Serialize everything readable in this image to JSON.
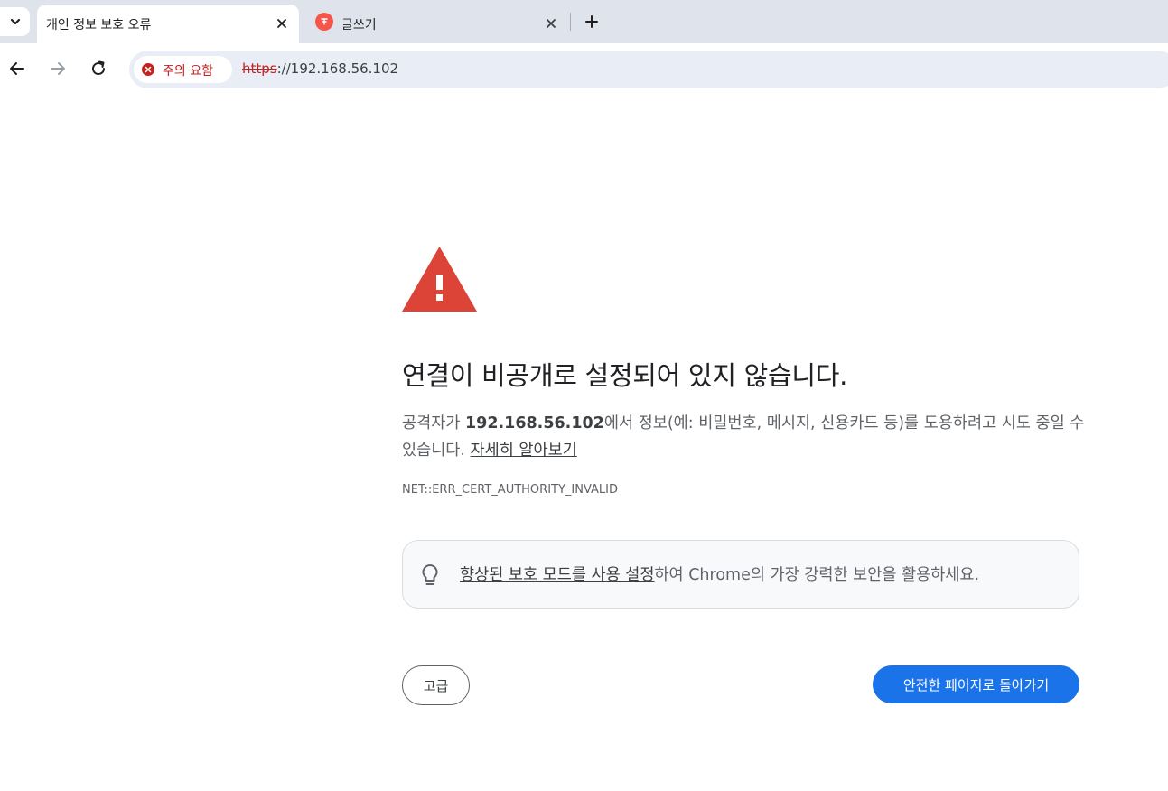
{
  "tabs": [
    {
      "title": "개인 정보 보호 오류",
      "active": true
    },
    {
      "title": "글쓰기",
      "active": false,
      "favicon_color": "#f4574a"
    }
  ],
  "toolbar": {
    "security_chip": "주의 요함",
    "url_scheme": "https",
    "url_rest": "://192.168.56.102"
  },
  "interstitial": {
    "heading": "연결이 비공개로 설정되어 있지 않습니다.",
    "desc_prefix": "공격자가 ",
    "desc_host": "192.168.56.102",
    "desc_suffix": "에서 정보(예: 비밀번호, 메시지, 신용카드 등)를 도용하려고 시도 중일 수 있습니다. ",
    "learn_more": "자세히 알아보기",
    "error_code": "NET::ERR_CERT_AUTHORITY_INVALID",
    "promo_link": "향상된 보호 모드를 사용 설정",
    "promo_rest": "하여 Chrome의 가장 강력한 보안을 활용하세요.",
    "advanced_button": "고급",
    "back_button": "안전한 페이지로 돌아가기"
  },
  "colors": {
    "tabstrip": "#dfe3eb",
    "warning_red": "#db4437",
    "primary_blue": "#1a73e8",
    "danger_text": "#c5221f"
  },
  "icons": [
    "tab-search-icon",
    "close-icon",
    "plus-icon",
    "back-arrow-icon",
    "forward-arrow-icon",
    "reload-icon",
    "not-secure-icon",
    "warning-triangle-icon",
    "lightbulb-icon"
  ]
}
